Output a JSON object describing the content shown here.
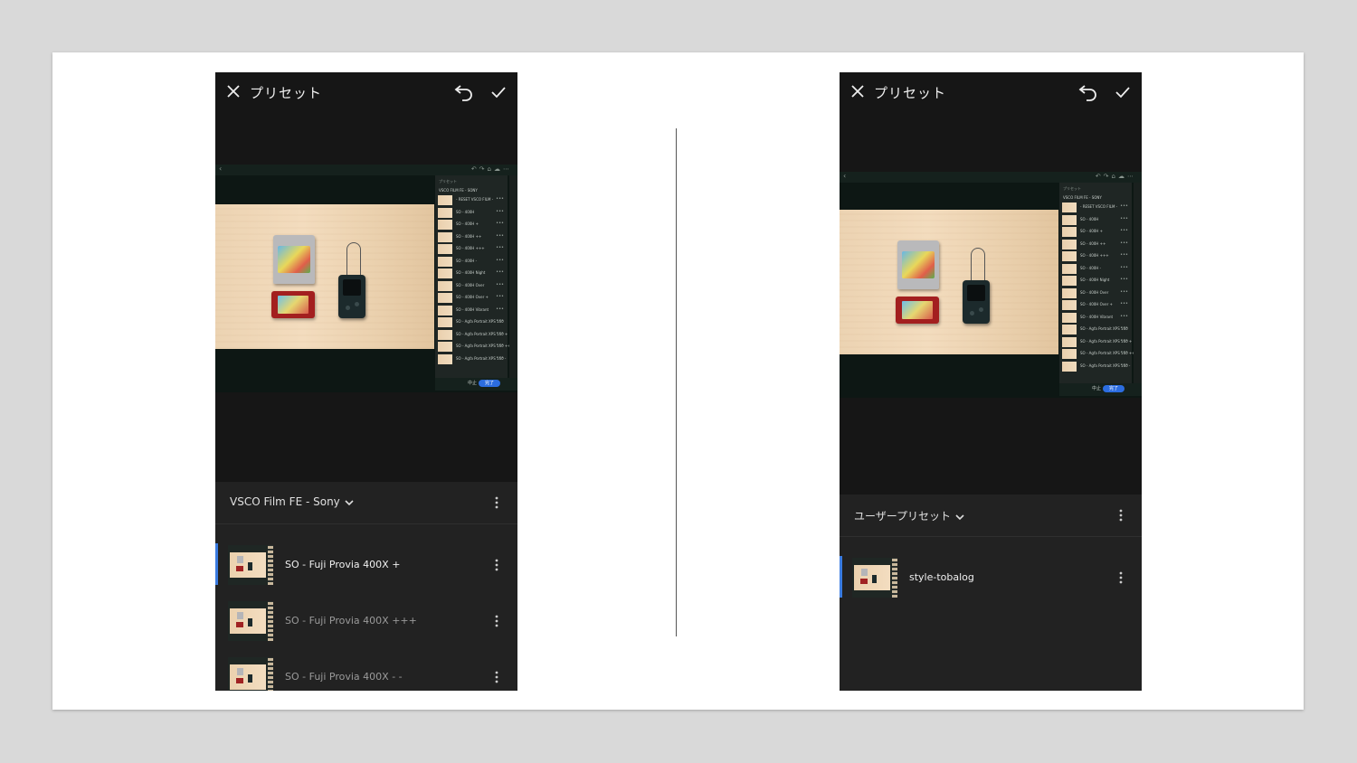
{
  "left_phone": {
    "title": "プリセット",
    "group_name": "VSCO Film FE - Sony",
    "presets": [
      {
        "label": "SO - Fuji Provia 400X +",
        "selected": true
      },
      {
        "label": "SO - Fuji Provia 400X +++",
        "selected": false
      },
      {
        "label": "SO - Fuji Provia 400X - -",
        "selected": false
      }
    ]
  },
  "right_phone": {
    "title": "プリセット",
    "group_name": "ユーザープリセット",
    "presets": [
      {
        "label": "style-tobalog",
        "selected": true
      }
    ]
  },
  "embedded_screenshot": {
    "panel_head": "プリセット",
    "panel_sub": "VSCO FILM FE - SONY",
    "rows": [
      "- RESET VSCO FILM -",
      "SO - 400H",
      "SO - 400H +",
      "SO - 400H ++",
      "SO - 400H +++",
      "SO - 400H -",
      "SO - 400H Night",
      "SO - 400H Over",
      "SO - 400H Over +",
      "SO - 400H Vibrant",
      "SO - Agfa Portrait XPS 160",
      "SO - Agfa Portrait XPS 160 +",
      "SO - Agfa Portrait XPS 160 ++",
      "SO - Agfa Portrait XPS 160 -"
    ],
    "cancel_label": "中止",
    "done_label": "完了"
  },
  "colors": {
    "accent": "#3a7be0",
    "phone_bg": "#161616",
    "panel_bg": "#222222",
    "slide_bg": "#ffffff",
    "canvas_bg": "#d9d9d9"
  },
  "icons": [
    "close-icon",
    "undo-icon",
    "check-icon",
    "chevron-down-icon",
    "kebab-icon"
  ]
}
